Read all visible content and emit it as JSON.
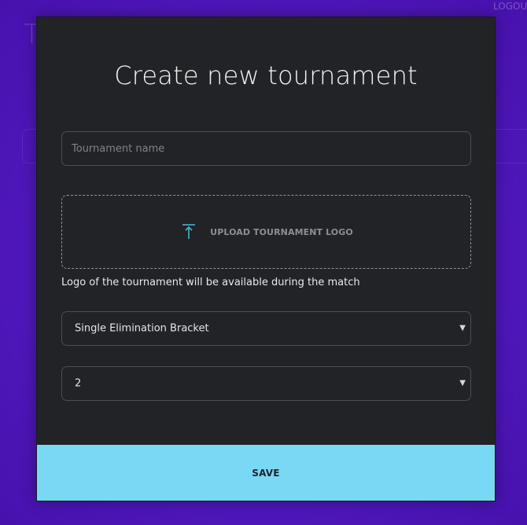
{
  "background": {
    "title_fragment": "T",
    "logout_label": "LOGOU"
  },
  "modal": {
    "title": "Create new tournament",
    "tournament_name": {
      "value": "",
      "placeholder": "Tournament name"
    },
    "upload": {
      "label": "UPLOAD TOURNAMENT LOGO",
      "icon": "upload-icon"
    },
    "helper_text": "Logo of the tournament will be available during the match",
    "bracket_type": {
      "selected": "Single Elimination Bracket"
    },
    "participant_count": {
      "selected": "2"
    },
    "save_label": "SAVE"
  },
  "colors": {
    "accent": "#79d9f4",
    "modal_bg": "#212327",
    "page_bg": "#5a1fc7",
    "icon_teal": "#4bb2c7"
  }
}
